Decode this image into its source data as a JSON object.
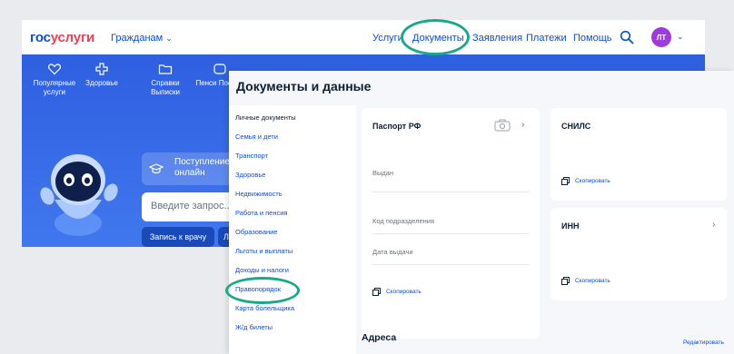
{
  "header": {
    "logo_part1": "гос",
    "logo_part2": "услуги",
    "citizens_menu": "Гражданам",
    "nav": {
      "services": "Услуги",
      "documents": "Документы",
      "applications": "Заявления",
      "payments": "Платежи",
      "help": "Помощь"
    },
    "avatar_initials": "ЛТ"
  },
  "hero": {
    "categories": [
      {
        "icon": "heart-icon",
        "label": "Популярные услуги"
      },
      {
        "icon": "health-cross-icon",
        "label": "Здоровье"
      },
      {
        "icon": "folder-icon",
        "label": "Справки Выписки"
      },
      {
        "icon": "pension-icon",
        "label": "Пенси Пособи"
      }
    ],
    "procedure_text": "Поступление в онлайн",
    "search_placeholder": "Введите запрос...",
    "doctor_button": "Запись к врачу",
    "second_button": "Л"
  },
  "documents_page": {
    "title": "Документы и данные",
    "sidenav": [
      "Личные документы",
      "Семья и дети",
      "Транспорт",
      "Здоровье",
      "Недвижимость",
      "Работа и пенсия",
      "Образование",
      "Льготы и выплаты",
      "Доходы и налоги",
      "Правопорядок",
      "Карта болельщика",
      "Ж/д билеты"
    ],
    "passport": {
      "title": "Паспорт РФ",
      "issued_label": "Выдан",
      "division_code_label": "Код подразделения",
      "issue_date_label": "Дата выдачи",
      "copy_label": "Скопировать"
    },
    "snils": {
      "title": "СНИЛС",
      "copy_label": "Скопировать"
    },
    "inn": {
      "title": "ИНН",
      "copy_label": "Скопировать"
    },
    "addresses_title": "Адреса",
    "edit_link": "Редактировать"
  },
  "colors": {
    "brand_blue": "#0d4cd3",
    "brand_red": "#ee3f58",
    "hero_blue": "#3d6fea",
    "highlight_teal": "#1aa88a",
    "avatar_purple": "#9d3bde"
  }
}
